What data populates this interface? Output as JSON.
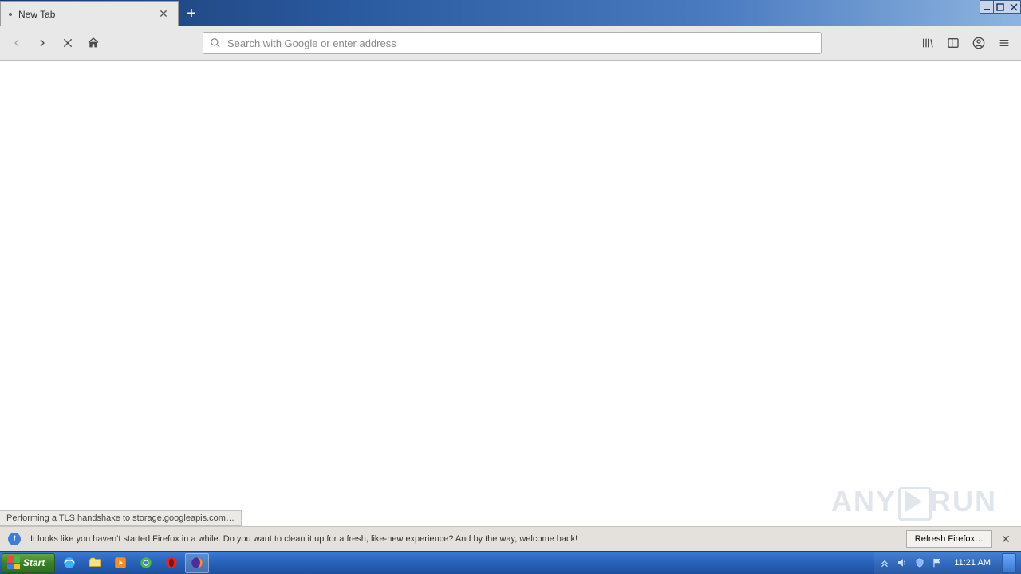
{
  "window": {
    "minimize": "_",
    "maximize": "❐",
    "close": "✕"
  },
  "tab": {
    "title": "New Tab"
  },
  "toolbar": {
    "url_placeholder": "Search with Google or enter address"
  },
  "status": {
    "text": "Performing a TLS handshake to storage.googleapis.com…"
  },
  "notification": {
    "message": "It looks like you haven't started Firefox in a while. Do you want to clean it up for a fresh, like-new experience? And by the way, welcome back!",
    "button": "Refresh Firefox…"
  },
  "taskbar": {
    "start": "Start",
    "clock": "11:21 AM"
  },
  "watermark": {
    "brand_a": "ANY",
    "brand_b": "RUN"
  }
}
